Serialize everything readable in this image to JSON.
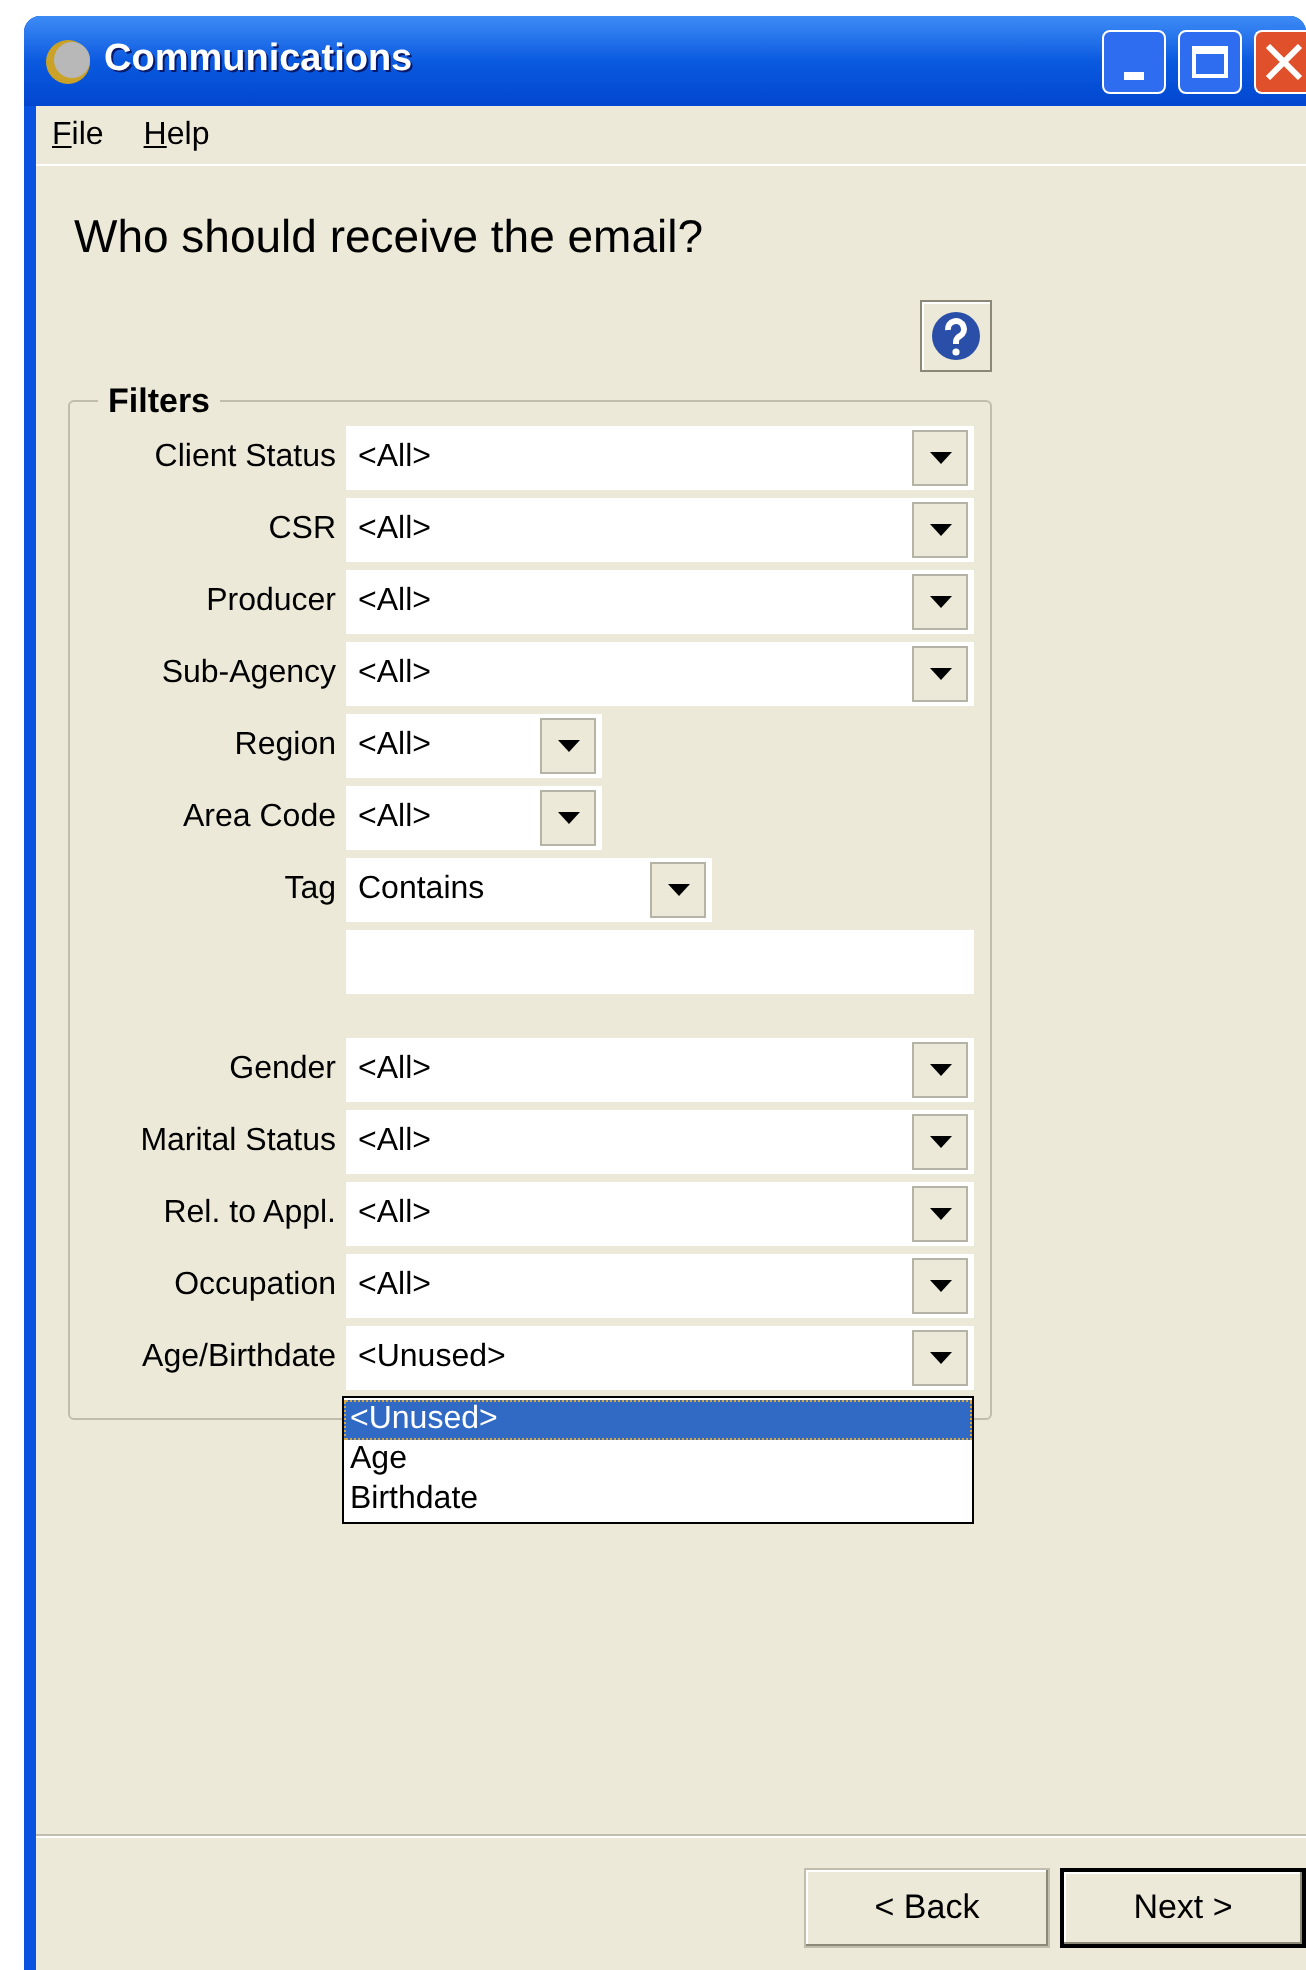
{
  "window": {
    "title": "Communications"
  },
  "menu": [
    {
      "label": "File"
    },
    {
      "label": "Help"
    }
  ],
  "heading": "Who should receive the email?",
  "filters": {
    "title": "Filters",
    "fields": [
      {
        "label": "Client Status",
        "kind": "combo_wide",
        "value": "<All>"
      },
      {
        "label": "CSR",
        "kind": "combo_wide",
        "value": "<All>"
      },
      {
        "label": "Producer",
        "kind": "combo_wide",
        "value": "<All>"
      },
      {
        "label": "Sub-Agency",
        "kind": "combo_wide",
        "value": "<All>"
      },
      {
        "label": "Region",
        "kind": "combo_short",
        "value": "<All>"
      },
      {
        "label": "Area Code",
        "kind": "combo_short",
        "value": "<All>"
      },
      {
        "label": "Tag",
        "kind": "combo_medium",
        "value": "Contains"
      },
      {
        "kind": "text"
      },
      {
        "label": "Gender",
        "kind": "combo_wide",
        "value": "<All>"
      },
      {
        "label": "Marital Status",
        "kind": "combo_wide",
        "value": "<All>"
      },
      {
        "label": "Rel. to Appl.",
        "kind": "combo_wide",
        "value": "<All>"
      },
      {
        "label": "Occupation",
        "kind": "combo_wide",
        "value": "<All>"
      },
      {
        "label": "Age/Birthdate",
        "kind": "combo_wide",
        "value": "<Unused>",
        "open": true,
        "options": [
          {
            "label": "<Unused>",
            "selected": true
          },
          {
            "label": "Age",
            "selected": false
          },
          {
            "label": "Birthdate",
            "selected": false
          }
        ]
      }
    ]
  },
  "buttons": [
    {
      "label": "< Back",
      "default": false
    },
    {
      "label": "Next >",
      "default": true
    }
  ]
}
